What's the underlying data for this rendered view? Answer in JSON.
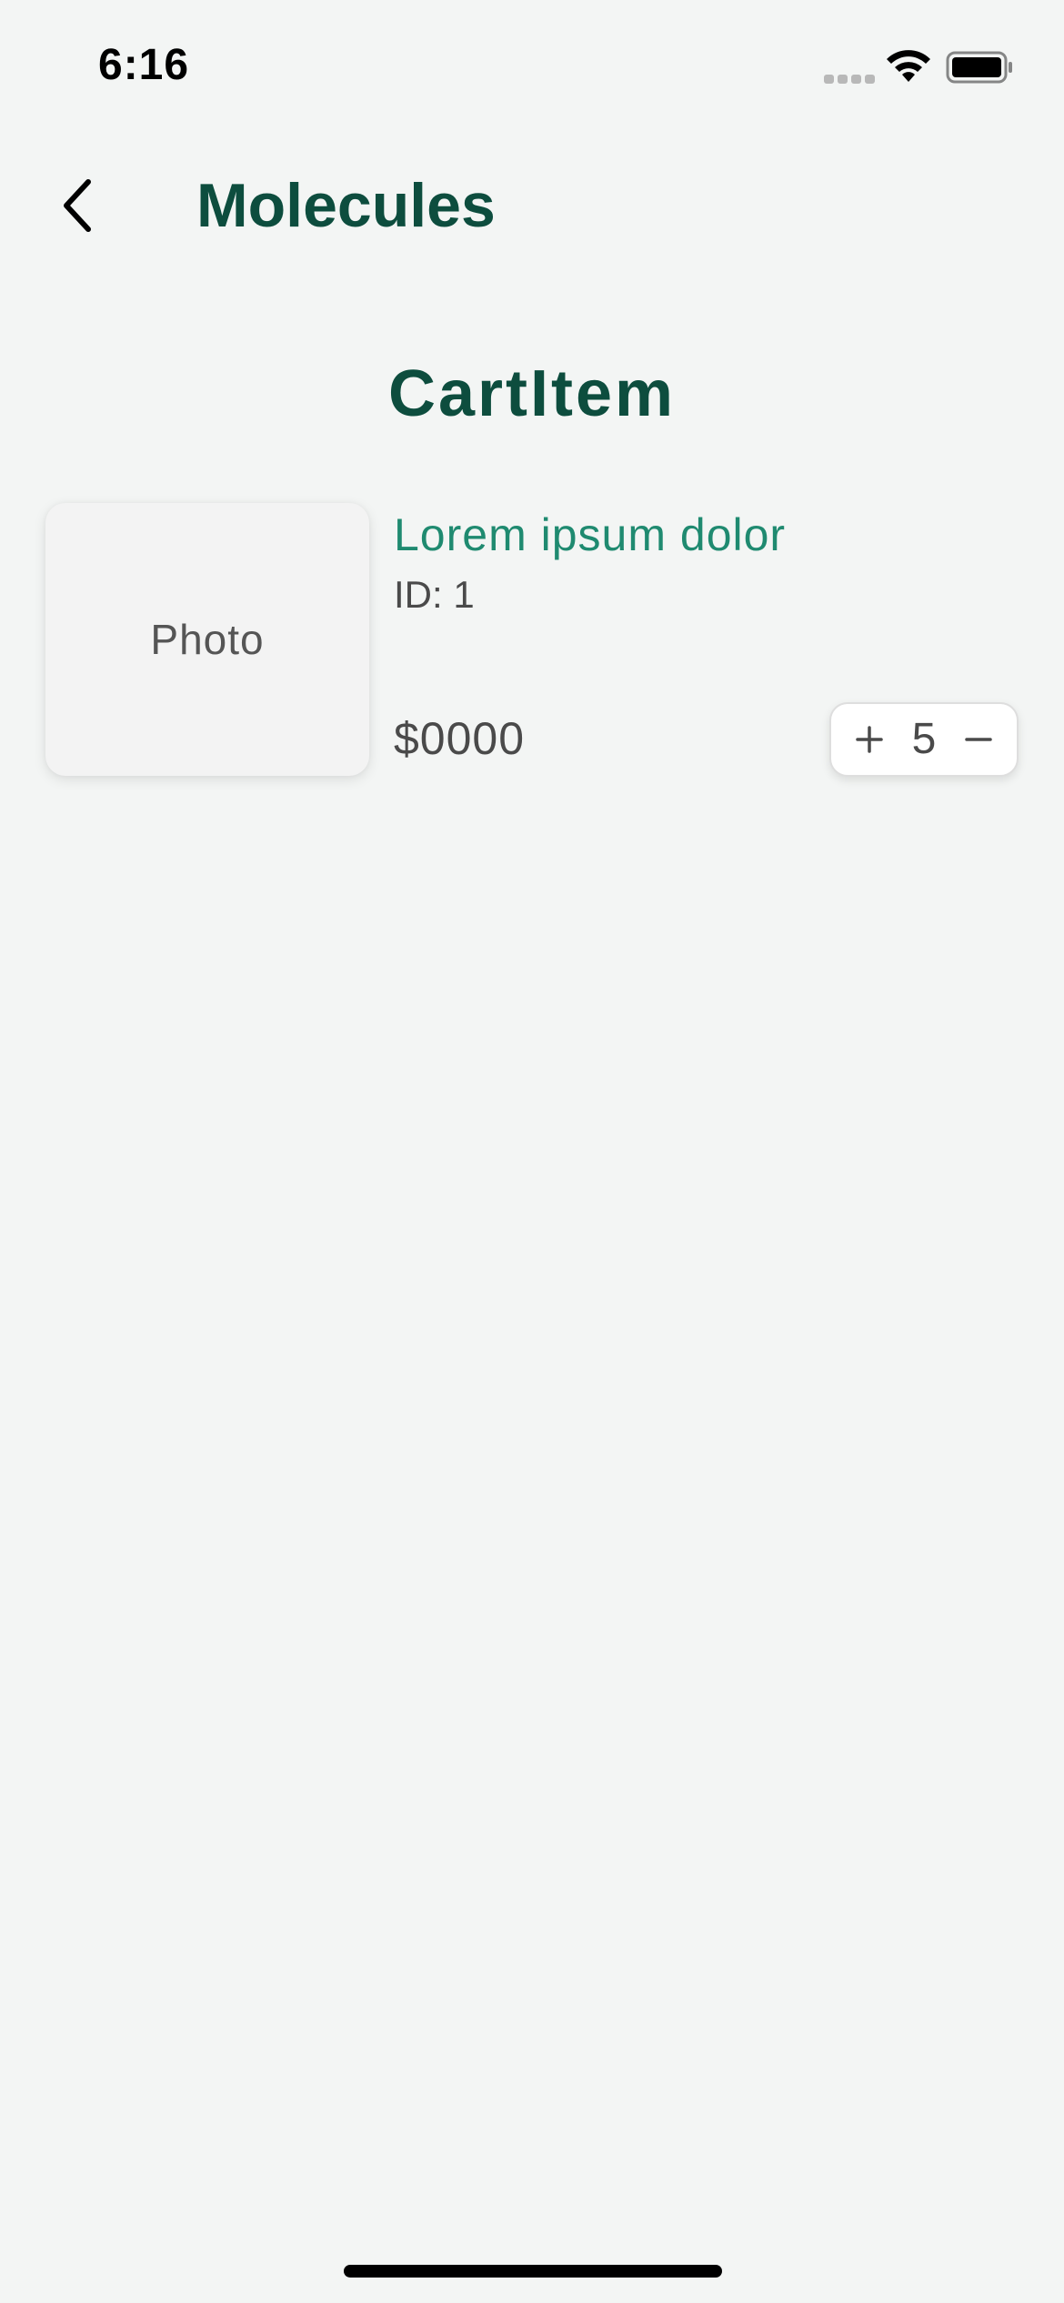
{
  "status_bar": {
    "time": "6:16",
    "icons": [
      "signal-dots-icon",
      "wifi-icon",
      "battery-icon"
    ]
  },
  "nav": {
    "back_icon": "chevron-left-icon",
    "title": "Molecules"
  },
  "section": {
    "title": "CartItem"
  },
  "cart_item": {
    "photo_label": "Photo",
    "name": "Lorem ipsum dolor",
    "id_text": "ID: 1",
    "price": "$0000",
    "quantity": "5",
    "increment_icon": "plus-icon",
    "decrement_icon": "minus-icon"
  },
  "colors": {
    "background": "#f3f5f4",
    "title": "#0d4d3e",
    "accent": "#1f8a70",
    "text": "#4a4a4a"
  }
}
